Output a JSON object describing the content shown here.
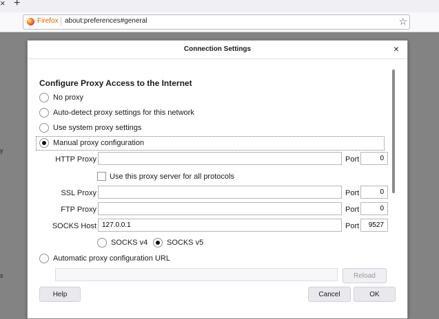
{
  "browser": {
    "tab_close": "×",
    "tab_new": "+",
    "identity_label": "Firefox",
    "url": "about:preferences#general",
    "bookmark_star": "☆",
    "bg_fragment_1": "y",
    "bg_fragment_2": "s"
  },
  "dialog": {
    "title": "Connection Settings",
    "close": "×",
    "heading": "Configure Proxy Access to the Internet",
    "options": {
      "no_proxy": "No proxy",
      "auto_detect": "Auto-detect proxy settings for this network",
      "system": "Use system proxy settings",
      "manual": "Manual proxy configuration",
      "auto_url": "Automatic proxy configuration URL"
    },
    "selected_option": "manual",
    "http": {
      "label": "HTTP Proxy",
      "value": "",
      "port_label": "Port",
      "port": "0"
    },
    "use_for_all": {
      "label": "Use this proxy server for all protocols",
      "checked": false
    },
    "ssl": {
      "label": "SSL Proxy",
      "value": "",
      "port_label": "Port",
      "port": "0"
    },
    "ftp": {
      "label": "FTP Proxy",
      "value": "",
      "port_label": "Port",
      "port": "0"
    },
    "socks": {
      "label": "SOCKS Host",
      "value": "127.0.0.1",
      "port_label": "Port",
      "port": "9527"
    },
    "socks_v4": "SOCKS v4",
    "socks_v5": "SOCKS v5",
    "socks_version_selected": "v5",
    "autoconfig_url": "",
    "reload_button": "Reload",
    "help_button": "Help",
    "cancel_button": "Cancel",
    "ok_button": "OK"
  }
}
